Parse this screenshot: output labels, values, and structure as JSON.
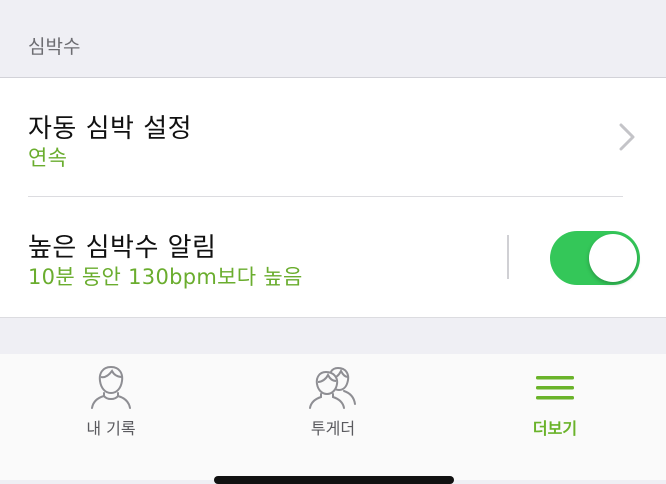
{
  "section": {
    "title": "심박수"
  },
  "rows": [
    {
      "title": "자동 심박 설정",
      "subtitle": "연속"
    },
    {
      "title": "높은 심박수 알림",
      "subtitle": "10분 동안 130bpm보다 높음",
      "toggle_on": true
    }
  ],
  "tabbar": {
    "tabs": [
      {
        "label": "내 기록",
        "icon": "person-icon"
      },
      {
        "label": "투게더",
        "icon": "people-icon"
      },
      {
        "label": "더보기",
        "icon": "menu-icon",
        "active": true
      }
    ]
  },
  "colors": {
    "accent_green": "#6aad2e",
    "toggle_green": "#34c759"
  }
}
